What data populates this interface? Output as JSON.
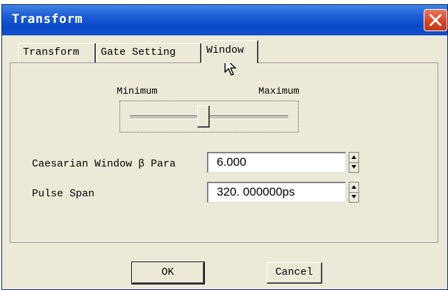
{
  "window": {
    "title": "Transform"
  },
  "tabs": [
    {
      "label": "Transform"
    },
    {
      "label": "Gate Setting"
    },
    {
      "label": "Window"
    }
  ],
  "slider": {
    "min_label": "Minimum",
    "max_label": "Maximum",
    "position_fraction": 0.46
  },
  "fields": {
    "caesarian": {
      "label": "Caesarian Window β Para",
      "value": "6.000"
    },
    "pulse": {
      "label": "Pulse Span",
      "value": "320. 000000ps"
    }
  },
  "buttons": {
    "ok": "OK",
    "cancel": "Cancel"
  },
  "colors": {
    "titlebar": "#0a49c8",
    "close": "#d9431e",
    "face": "#ece9d8"
  }
}
